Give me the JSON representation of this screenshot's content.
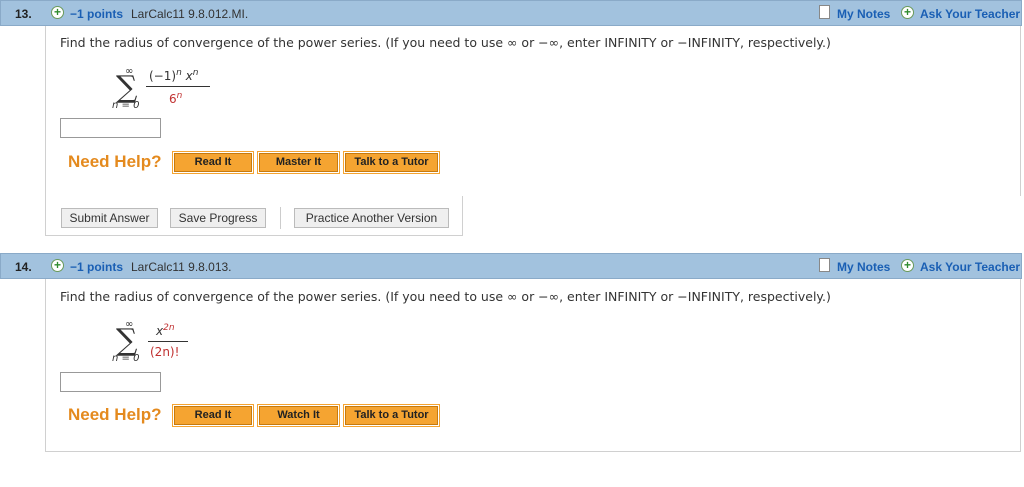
{
  "q13": {
    "number": "13.",
    "points": "−1 points",
    "source": "LarCalc11 9.8.012.MI.",
    "my_notes": "My Notes",
    "ask_teacher": "Ask Your Teacher",
    "prompt": "Find the radius of convergence of the power series. (If you need to use ∞ or −∞, enter INFINITY or −INFINITY, respectively.)",
    "sum_upper": "∞",
    "sum_lower": "n = 0",
    "numerator": "(−1)",
    "numerator_exp": "n",
    "numerator_var": "x",
    "numerator_var_exp": "n",
    "denominator": "6",
    "denominator_exp": "n",
    "need_help": "Need Help?",
    "buttons": [
      "Read It",
      "Master It",
      "Talk to a Tutor"
    ],
    "submit": "Submit Answer",
    "save": "Save Progress",
    "practice": "Practice Another Version"
  },
  "q14": {
    "number": "14.",
    "points": "−1 points",
    "source": "LarCalc11 9.8.013.",
    "my_notes": "My Notes",
    "ask_teacher": "Ask Your Teacher",
    "prompt": "Find the radius of convergence of the power series. (If you need to use ∞ or −∞, enter INFINITY or −INFINITY, respectively.)",
    "sum_upper": "∞",
    "sum_lower": "n = 0",
    "numerator_var": "x",
    "numerator_exp": "2n",
    "denominator": "(2n)!",
    "need_help": "Need Help?",
    "buttons": [
      "Read It",
      "Watch It",
      "Talk to a Tutor"
    ]
  }
}
